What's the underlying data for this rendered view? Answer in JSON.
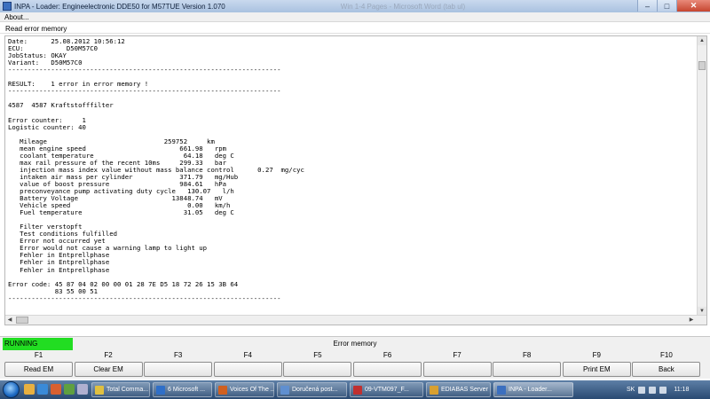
{
  "window": {
    "title": "INPA - Loader:  Engineelectronic DDE50 for M57TUE Version 1.070",
    "background_title": "Win 1-4 Pages - Microsoft Word (tab ul)"
  },
  "menu": {
    "about": "About..."
  },
  "section": {
    "header": "Read error memory"
  },
  "content_lines": [
    "Date:      25.08.2012 10:56:12",
    "ECU:           D50M57C0",
    "JobStatus: OKAY",
    "Variant:   D50M57C0",
    "----------------------------------------------------------------------",
    "",
    "RESULT:    1 error in error memory !",
    "----------------------------------------------------------------------",
    "",
    "4587  4587 Kraftstofffilter",
    "",
    "Error counter:     1",
    "Logistic counter: 40",
    "",
    "   Mileage                              259752     km",
    "   mean engine speed                        661.98   rpm",
    "   coolant temperature                       64.18   deg C",
    "   max rail pressure of the recent 10ms     299.33   bar",
    "   injection mass index value without mass balance control      0.27  mg/cyc",
    "   intaken air mass per cylinder            371.79   mg/Hub",
    "   value of boost pressure                  984.61   hPa",
    "   preconveyance pump activating duty cycle   130.07   l/h",
    "   Battery Voltage                        13848.74   mV",
    "   Vehicle speed                              0.00   km/h",
    "   Fuel temperature                          31.05   deg C",
    "",
    "   Filter verstopft",
    "   Test conditions fulfilled",
    "   Error not occurred yet",
    "   Error would not cause a warning lamp to light up",
    "   Fehler in Entprellphase",
    "   Fehler in Entprellphase",
    "   Fehler in Entprellphase",
    "",
    "Error code: 45 87 04 02 00 00 01 28 7E D5 18 72 26 15 3B 64",
    "            83 55 00 51",
    "----------------------------------------------------------------------",
    ""
  ],
  "status": {
    "running": "RUNNING",
    "title": "Error memory"
  },
  "fkeys": [
    {
      "key": "F1",
      "label": "Read EM"
    },
    {
      "key": "F2",
      "label": "Clear EM"
    },
    {
      "key": "F3",
      "label": ""
    },
    {
      "key": "F4",
      "label": ""
    },
    {
      "key": "F5",
      "label": ""
    },
    {
      "key": "F6",
      "label": ""
    },
    {
      "key": "F7",
      "label": ""
    },
    {
      "key": "F8",
      "label": ""
    },
    {
      "key": "F9",
      "label": "Print EM"
    },
    {
      "key": "F10",
      "label": "Back"
    }
  ],
  "taskbar": {
    "tasks": [
      {
        "label": "Total Comma...",
        "icon": "total-commander-icon",
        "color": "#e0c040"
      },
      {
        "label": "6 Microsoft ...",
        "icon": "word-icon",
        "color": "#2f6fc8"
      },
      {
        "label": "Voices Of The ...",
        "icon": "media-icon",
        "color": "#d06020"
      },
      {
        "label": "Doručená post...",
        "icon": "mail-icon",
        "color": "#5f8fd0"
      },
      {
        "label": "09-VTM097_F...",
        "icon": "pdf-icon",
        "color": "#c03030"
      },
      {
        "label": "EDIABAS Server",
        "icon": "ediabas-icon",
        "color": "#d8a030"
      },
      {
        "label": "INPA - Loader...",
        "icon": "inpa-icon",
        "color": "#3b6fbf"
      }
    ],
    "lang": "SK",
    "clock": "11:18"
  },
  "colors": {
    "running": "#22dd22",
    "taskbar": "#2a4a72"
  }
}
